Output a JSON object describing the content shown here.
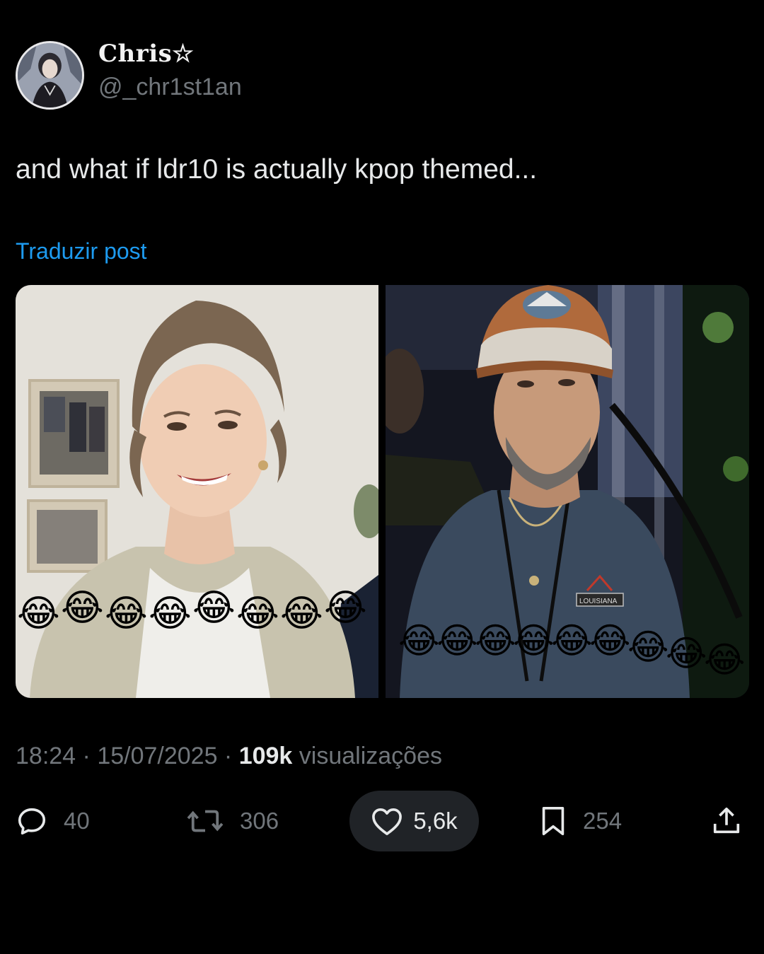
{
  "author": {
    "display_name": "Chris☆",
    "handle": "@_chr1st1an"
  },
  "post": {
    "text": "and what if ldr10 is actually kpop themed...",
    "translate_label": "Traduzir post"
  },
  "media": {
    "left_photo_emoji": "😂😂😂😂😂😂😂😂",
    "right_photo_emoji": "😂😂😂😂😂😂😂😂😂",
    "cap_patch_text": "LOUISIANA"
  },
  "meta": {
    "time": "18:24",
    "separator": " · ",
    "date": "15/07/2025",
    "views_count": "109k",
    "views_label": " visualizações"
  },
  "actions": {
    "replies": "40",
    "reposts": "306",
    "likes": "5,6k",
    "bookmarks": "254"
  },
  "icons": {
    "reply": "reply-icon",
    "repost": "repost-icon",
    "like": "heart-icon",
    "bookmark": "bookmark-icon",
    "share": "share-icon"
  },
  "colors": {
    "background": "#000000",
    "link": "#1d9bf0",
    "secondary_text": "#71767b",
    "primary_text": "#e7e9ea",
    "like_pill": "#202327"
  }
}
